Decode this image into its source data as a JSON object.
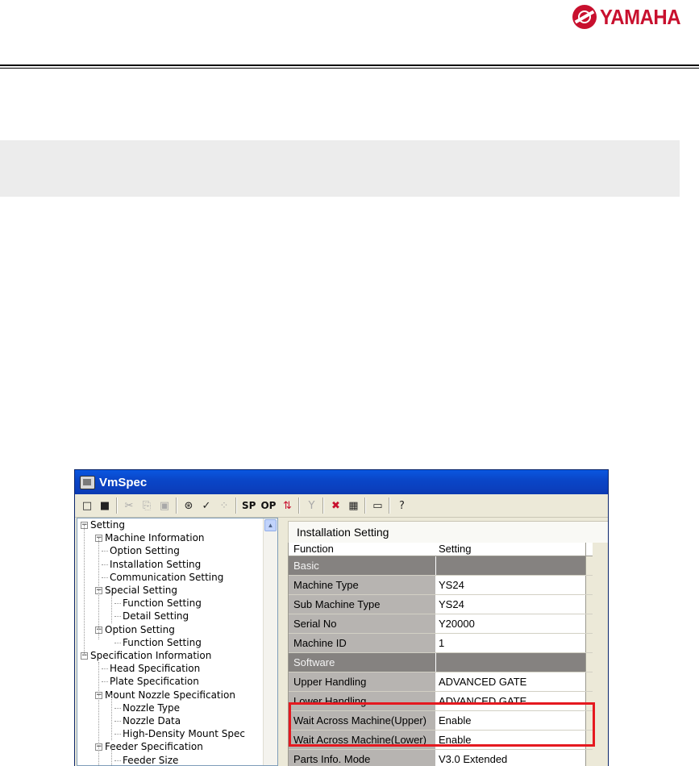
{
  "logo": {
    "text": "YAMAHA",
    "color": "#c8102e"
  },
  "window": {
    "title": "VmSpec",
    "toolbar": {
      "new_icon": "□",
      "save_icon": "■",
      "cut_icon": "✂",
      "copy_icon": "⎘",
      "paste_icon": "▣",
      "tool1_icon": "⊛",
      "tool2_icon": "✓",
      "tool3_icon": "⁘",
      "sp_label": "SP",
      "op_label": "OP",
      "transfer_icon": "⇅",
      "filter_icon": "Y",
      "tool4_icon": "✖",
      "tool5_icon": "▦",
      "tool6_icon": "▭",
      "help_icon": "?"
    },
    "tree": [
      {
        "label": "Setting",
        "level": 0,
        "expander": "−"
      },
      {
        "label": "Machine Information",
        "level": 1,
        "expander": "−"
      },
      {
        "label": "Option Setting",
        "level": 2
      },
      {
        "label": "Installation Setting",
        "level": 2,
        "selected": true
      },
      {
        "label": "Communication Setting",
        "level": 2
      },
      {
        "label": "Special Setting",
        "level": 1,
        "expander": "−"
      },
      {
        "label": "Function Setting",
        "level": 2,
        "indent": 1
      },
      {
        "label": "Detail Setting",
        "level": 2,
        "indent": 1
      },
      {
        "label": "Option Setting",
        "level": 1,
        "expander": "−"
      },
      {
        "label": "Function Setting",
        "level": 2,
        "indent": 1
      },
      {
        "label": "Specification Information",
        "level": 0,
        "expander": "−"
      },
      {
        "label": "Head Specification",
        "level": 2
      },
      {
        "label": "Plate Specification",
        "level": 2
      },
      {
        "label": "Mount Nozzle Specification",
        "level": 1,
        "expander": "−"
      },
      {
        "label": "Nozzle Type",
        "level": 2,
        "indent": 1
      },
      {
        "label": "Nozzle Data",
        "level": 2,
        "indent": 1
      },
      {
        "label": "High-Density Mount Spec",
        "level": 2,
        "indent": 1
      },
      {
        "label": "Feeder Specification",
        "level": 1,
        "expander": "−"
      },
      {
        "label": "Feeder Size",
        "level": 2,
        "indent": 1
      }
    ],
    "panel": {
      "title": "Installation Setting",
      "header": {
        "function": "Function",
        "setting": "Setting"
      },
      "rows": [
        {
          "function": "Basic",
          "setting": "",
          "section": true
        },
        {
          "function": "Machine Type",
          "setting": "YS24"
        },
        {
          "function": "Sub Machine Type",
          "setting": "YS24"
        },
        {
          "function": "Serial No",
          "setting": "Y20000"
        },
        {
          "function": "Machine ID",
          "setting": "1"
        },
        {
          "function": "Software",
          "setting": "",
          "section": true
        },
        {
          "function": "Upper Handling",
          "setting": "ADVANCED GATE"
        },
        {
          "function": "Lower Handling",
          "setting": "ADVANCED GATE"
        },
        {
          "function": "Wait Across Machine(Upper)",
          "setting": "Enable"
        },
        {
          "function": "Wait Across Machine(Lower)",
          "setting": "Enable"
        },
        {
          "function": "Parts Info. Mode",
          "setting": "V3.0 Extended"
        }
      ]
    },
    "highlight_color": "#e51920"
  }
}
